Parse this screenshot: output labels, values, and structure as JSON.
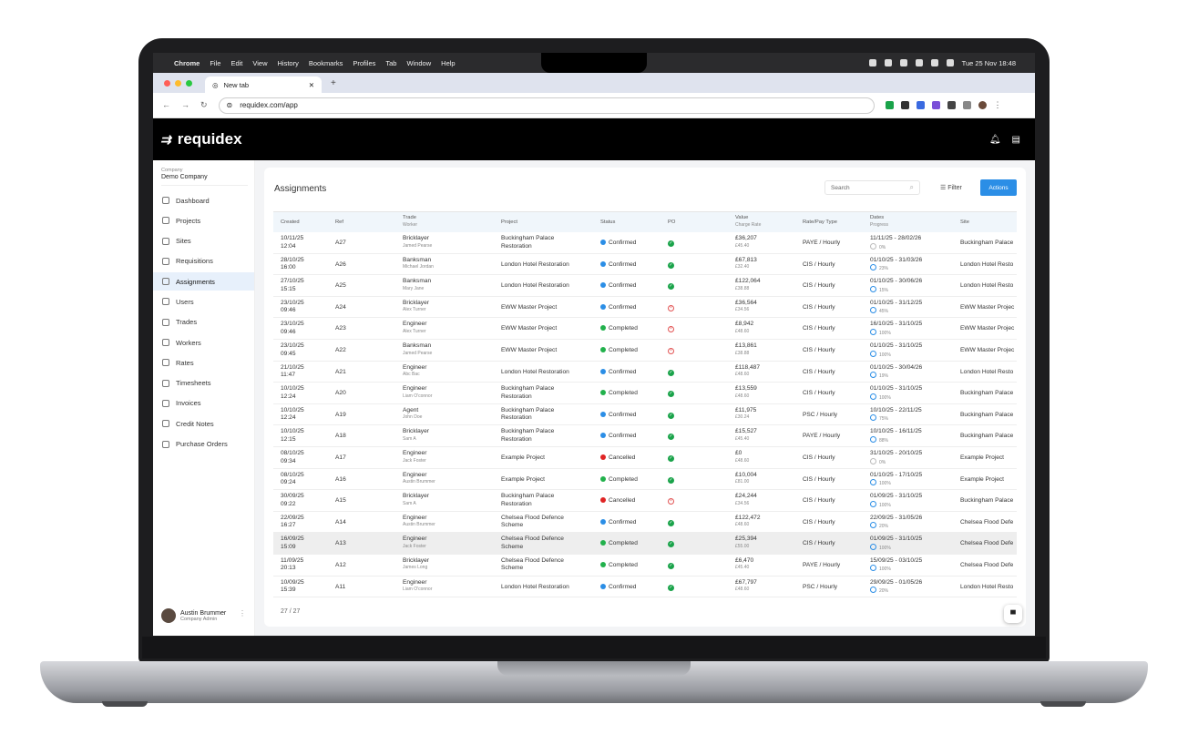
{
  "mac_menubar": {
    "app": "Chrome",
    "items": [
      "File",
      "Edit",
      "View",
      "History",
      "Bookmarks",
      "Profiles",
      "Tab",
      "Window",
      "Help"
    ],
    "clock": "Tue 25 Nov  18:48"
  },
  "browser": {
    "tab_title": "New tab",
    "url": "requidex.com/app"
  },
  "app": {
    "brand": "requidex",
    "company_label": "Company",
    "company_name": "Demo Company",
    "menu": [
      {
        "label": "Dashboard",
        "icon": "grid-icon"
      },
      {
        "label": "Projects",
        "icon": "building-icon"
      },
      {
        "label": "Sites",
        "icon": "location-pin-icon"
      },
      {
        "label": "Requisitions",
        "icon": "document-icon"
      },
      {
        "label": "Assignments",
        "icon": "id-card-icon",
        "active": true
      },
      {
        "label": "Users",
        "icon": "users-icon"
      },
      {
        "label": "Trades",
        "icon": "tools-icon"
      },
      {
        "label": "Workers",
        "icon": "workers-icon"
      },
      {
        "label": "Rates",
        "icon": "coin-icon"
      },
      {
        "label": "Timesheets",
        "icon": "calendar-icon"
      },
      {
        "label": "Invoices",
        "icon": "invoice-icon"
      },
      {
        "label": "Credit Notes",
        "icon": "credit-note-icon"
      },
      {
        "label": "Purchase Orders",
        "icon": "purchase-order-icon"
      }
    ],
    "user": {
      "name": "Austin Brummer",
      "role": "Company Admin"
    }
  },
  "page": {
    "title": "Assignments",
    "search_placeholder": "Search",
    "filter_label": "Filter",
    "actions_label": "Actions",
    "footer_count": "27 / 27"
  },
  "table": {
    "headers": {
      "created": "Created",
      "ref": "Ref",
      "trade": "Trade",
      "trade_sub": "Worker",
      "project": "Project",
      "status": "Status",
      "po": "PO",
      "value": "Value",
      "value_sub": "Charge Rate",
      "rate_type": "Rate/Pay Type",
      "dates": "Dates",
      "dates_sub": "Progress",
      "site": "Site"
    },
    "status_colors": {
      "Confirmed": "#2b8ee6",
      "Completed": "#22b14c",
      "Cancelled": "#e02424"
    },
    "rows": [
      {
        "date": "10/11/25",
        "time": "12:04",
        "ref": "A27",
        "trade": "Bricklayer",
        "worker": "Jamed Pearse",
        "project": "Buckingham Palace",
        "project2": "Restoration",
        "status": "Confirmed",
        "po": true,
        "value": "£36,207",
        "rate": "£45.40",
        "type": "PAYE / Hourly",
        "dates": "11/11/25 - 28/02/26",
        "progress": "0%",
        "site": "Buckingham Palace"
      },
      {
        "date": "28/10/25",
        "time": "16:00",
        "ref": "A26",
        "trade": "Banksman",
        "worker": "Michael Jordan",
        "project": "London Hotel Restoration",
        "project2": "",
        "status": "Confirmed",
        "po": true,
        "value": "£67,813",
        "rate": "£32.40",
        "type": "CIS / Hourly",
        "dates": "01/10/25 - 31/03/26",
        "progress": "23%",
        "site": "London Hotel Resto"
      },
      {
        "date": "27/10/25",
        "time": "15:15",
        "ref": "A25",
        "trade": "Banksman",
        "worker": "Mary Jane",
        "project": "London Hotel Restoration",
        "project2": "",
        "status": "Confirmed",
        "po": true,
        "value": "£122,064",
        "rate": "£38.88",
        "type": "CIS / Hourly",
        "dates": "01/10/25 - 30/06/26",
        "progress": "15%",
        "site": "London Hotel Resto"
      },
      {
        "date": "23/10/25",
        "time": "09:46",
        "ref": "A24",
        "trade": "Bricklayer",
        "worker": "Alex Turner",
        "project": "EWW Master Project",
        "project2": "",
        "status": "Confirmed",
        "po": false,
        "value": "£36,564",
        "rate": "£34.56",
        "type": "CIS / Hourly",
        "dates": "01/10/25 - 31/12/25",
        "progress": "45%",
        "site": "EWW Master Projec"
      },
      {
        "date": "23/10/25",
        "time": "09:46",
        "ref": "A23",
        "trade": "Engineer",
        "worker": "Alex Turner",
        "project": "EWW Master Project",
        "project2": "",
        "status": "Completed",
        "po": false,
        "value": "£8,942",
        "rate": "£48.60",
        "type": "CIS / Hourly",
        "dates": "16/10/25 - 31/10/25",
        "progress": "100%",
        "site": "EWW Master Projec"
      },
      {
        "date": "23/10/25",
        "time": "09:45",
        "ref": "A22",
        "trade": "Banksman",
        "worker": "Jamed Pearse",
        "project": "EWW Master Project",
        "project2": "",
        "status": "Completed",
        "po": false,
        "value": "£13,861",
        "rate": "£38.88",
        "type": "CIS / Hourly",
        "dates": "01/10/25 - 31/10/25",
        "progress": "100%",
        "site": "EWW Master Projec"
      },
      {
        "date": "21/10/25",
        "time": "11:47",
        "ref": "A21",
        "trade": "Engineer",
        "worker": "Abc Bac",
        "project": "London Hotel Restoration",
        "project2": "",
        "status": "Confirmed",
        "po": true,
        "value": "£118,487",
        "rate": "£48.60",
        "type": "CIS / Hourly",
        "dates": "01/10/25 - 30/04/26",
        "progress": "19%",
        "site": "London Hotel Resto"
      },
      {
        "date": "10/10/25",
        "time": "12:24",
        "ref": "A20",
        "trade": "Engineer",
        "worker": "Liam O'connor",
        "project": "Buckingham Palace",
        "project2": "Restoration",
        "status": "Completed",
        "po": true,
        "value": "£13,559",
        "rate": "£48.60",
        "type": "CIS / Hourly",
        "dates": "01/10/25 - 31/10/25",
        "progress": "100%",
        "site": "Buckingham Palace"
      },
      {
        "date": "10/10/25",
        "time": "12:24",
        "ref": "A19",
        "trade": "Agent",
        "worker": "John Doe",
        "project": "Buckingham Palace",
        "project2": "Restoration",
        "status": "Confirmed",
        "po": true,
        "value": "£11,975",
        "rate": "£30.24",
        "type": "PSC / Hourly",
        "dates": "10/10/25 - 22/11/25",
        "progress": "75%",
        "site": "Buckingham Palace"
      },
      {
        "date": "10/10/25",
        "time": "12:15",
        "ref": "A18",
        "trade": "Bricklayer",
        "worker": "Sam A",
        "project": "Buckingham Palace",
        "project2": "Restoration",
        "status": "Confirmed",
        "po": true,
        "value": "£15,527",
        "rate": "£45.40",
        "type": "PAYE / Hourly",
        "dates": "10/10/25 - 16/11/25",
        "progress": "88%",
        "site": "Buckingham Palace"
      },
      {
        "date": "08/10/25",
        "time": "09:34",
        "ref": "A17",
        "trade": "Engineer",
        "worker": "Jack Foster",
        "project": "Example Project",
        "project2": "",
        "status": "Cancelled",
        "po": true,
        "value": "£0",
        "rate": "£48.60",
        "type": "CIS / Hourly",
        "dates": "31/10/25 - 20/10/25",
        "progress": "0%",
        "site": "Example Project"
      },
      {
        "date": "08/10/25",
        "time": "09:24",
        "ref": "A16",
        "trade": "Engineer",
        "worker": "Austin Brummer",
        "project": "Example Project",
        "project2": "",
        "status": "Completed",
        "po": true,
        "value": "£10,004",
        "rate": "£81.00",
        "type": "CIS / Hourly",
        "dates": "01/10/25 - 17/10/25",
        "progress": "100%",
        "site": "Example Project"
      },
      {
        "date": "30/09/25",
        "time": "09:22",
        "ref": "A15",
        "trade": "Bricklayer",
        "worker": "Sam A",
        "project": "Buckingham Palace",
        "project2": "Restoration",
        "status": "Cancelled",
        "po": false,
        "value": "£24,244",
        "rate": "£34.56",
        "type": "CIS / Hourly",
        "dates": "01/09/25 - 31/10/25",
        "progress": "100%",
        "site": "Buckingham Palace"
      },
      {
        "date": "22/09/25",
        "time": "16:27",
        "ref": "A14",
        "trade": "Engineer",
        "worker": "Austin Brummer",
        "project": "Chelsea Flood Defence",
        "project2": "Scheme",
        "status": "Confirmed",
        "po": true,
        "value": "£122,472",
        "rate": "£48.60",
        "type": "CIS / Hourly",
        "dates": "22/09/25 - 31/05/26",
        "progress": "20%",
        "site": "Chelsea Flood Defe"
      },
      {
        "date": "16/09/25",
        "time": "15:09",
        "ref": "A13",
        "trade": "Engineer",
        "worker": "Jack Foster",
        "project": "Chelsea Flood Defence",
        "project2": "Scheme",
        "status": "Completed",
        "po": true,
        "value": "£25,394",
        "rate": "£55.00",
        "type": "CIS / Hourly",
        "dates": "01/09/25 - 31/10/25",
        "progress": "100%",
        "site": "Chelsea Flood Defe",
        "highlight": true
      },
      {
        "date": "11/09/25",
        "time": "20:13",
        "ref": "A12",
        "trade": "Bricklayer",
        "worker": "James Long",
        "project": "Chelsea Flood Defence",
        "project2": "Scheme",
        "status": "Completed",
        "po": true,
        "value": "£6,470",
        "rate": "£45.40",
        "type": "PAYE / Hourly",
        "dates": "15/09/25 - 03/10/25",
        "progress": "100%",
        "site": "Chelsea Flood Defe"
      },
      {
        "date": "10/09/25",
        "time": "15:39",
        "ref": "A11",
        "trade": "Engineer",
        "worker": "Liam O'connor",
        "project": "London Hotel Restoration",
        "project2": "",
        "status": "Confirmed",
        "po": true,
        "value": "£67,797",
        "rate": "£48.60",
        "type": "PSC / Hourly",
        "dates": "29/09/25 - 01/05/26",
        "progress": "20%",
        "site": "London Hotel Resto"
      }
    ]
  }
}
